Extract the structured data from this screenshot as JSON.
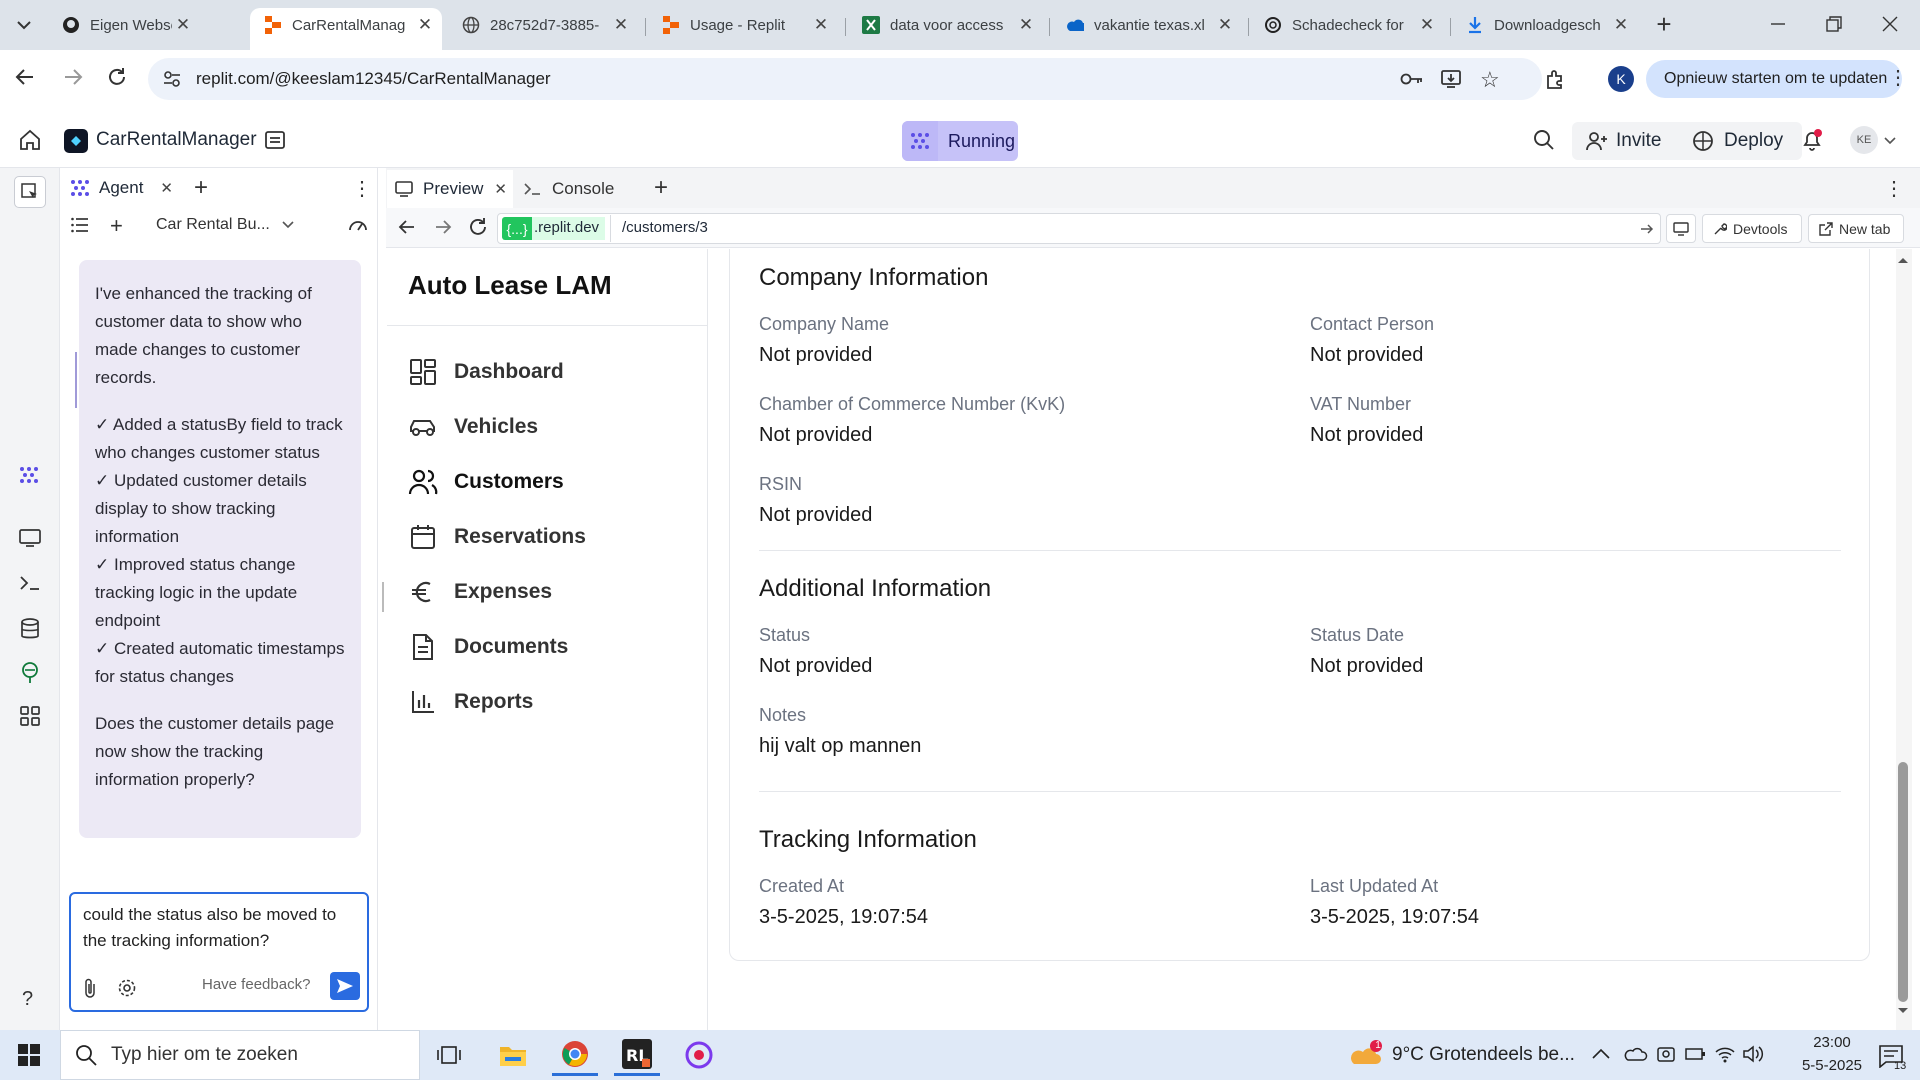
{
  "browser": {
    "tabs": [
      {
        "title": "Eigen Webserver"
      },
      {
        "title": "CarRentalManag"
      },
      {
        "title": "28c752d7-3885-"
      },
      {
        "title": "Usage - Replit"
      },
      {
        "title": "data voor access"
      },
      {
        "title": "vakantie texas.xl"
      },
      {
        "title": "Schadecheck for"
      },
      {
        "title": "Downloadgesch"
      }
    ],
    "url": "replit.com/@keeslam12345/CarRentalManager",
    "update_button": "Opnieuw starten om te updaten",
    "profile_initial": "K"
  },
  "replit": {
    "project_name": "CarRentalManager",
    "status": "Running",
    "invite": "Invite",
    "deploy": "Deploy",
    "avatar": "KE"
  },
  "agent": {
    "tab_label": "Agent",
    "thread_title": "Car Rental Bu...",
    "message": {
      "intro": "I've enhanced the tracking of customer data to show who made changes to customer records.",
      "items": [
        "✓ Added a statusBy field to track who changes customer status",
        "✓ Updated customer details display to show tracking information",
        "✓ Improved status change tracking logic in the update endpoint",
        "✓ Created automatic timestamps for status changes"
      ],
      "question": "Does the customer details page now show the tracking information properly?"
    },
    "composer_text": "could the status also be moved to the tracking information?",
    "feedback": "Have feedback?",
    "help": "?"
  },
  "preview": {
    "tabs": [
      {
        "label": "Preview"
      },
      {
        "label": "Console"
      }
    ],
    "domain_badge": "{...}",
    "domain": ".replit.dev",
    "path": "/customers/3",
    "devtools": "Devtools",
    "new_tab": "New tab"
  },
  "app": {
    "brand": "Auto Lease LAM",
    "nav": [
      {
        "label": "Dashboard",
        "icon": "dashboard-icon"
      },
      {
        "label": "Vehicles",
        "icon": "car-icon"
      },
      {
        "label": "Customers",
        "icon": "users-icon",
        "active": true
      },
      {
        "label": "Reservations",
        "icon": "calendar-icon"
      },
      {
        "label": "Expenses",
        "icon": "euro-icon"
      },
      {
        "label": "Documents",
        "icon": "document-icon"
      },
      {
        "label": "Reports",
        "icon": "chart-icon"
      }
    ],
    "company": {
      "title": "Company Information",
      "fields": [
        {
          "label": "Company Name",
          "value": "Not provided"
        },
        {
          "label": "Contact Person",
          "value": "Not provided"
        },
        {
          "label": "Chamber of Commerce Number (KvK)",
          "value": "Not provided"
        },
        {
          "label": "VAT Number",
          "value": "Not provided"
        },
        {
          "label": "RSIN",
          "value": "Not provided"
        }
      ]
    },
    "additional": {
      "title": "Additional Information",
      "fields": [
        {
          "label": "Status",
          "value": "Not provided"
        },
        {
          "label": "Status Date",
          "value": "Not provided"
        },
        {
          "label": "Notes",
          "value": "hij valt op mannen"
        }
      ]
    },
    "tracking": {
      "title": "Tracking Information",
      "fields": [
        {
          "label": "Created At",
          "value": "3-5-2025, 19:07:54"
        },
        {
          "label": "Last Updated At",
          "value": "3-5-2025, 19:07:54"
        }
      ]
    }
  },
  "taskbar": {
    "search_placeholder": "Typ hier om te zoeken",
    "weather": "9°C  Grotendeels be...",
    "weather_badge": "1",
    "time": "23:00",
    "date": "5-5-2025",
    "notif_count": "13"
  },
  "colors": {
    "accent_blue": "#2a6be0",
    "running_pill": "#c6c2f8",
    "agent_bubble": "#ece9f5",
    "domain_badge": "#22c55e"
  }
}
